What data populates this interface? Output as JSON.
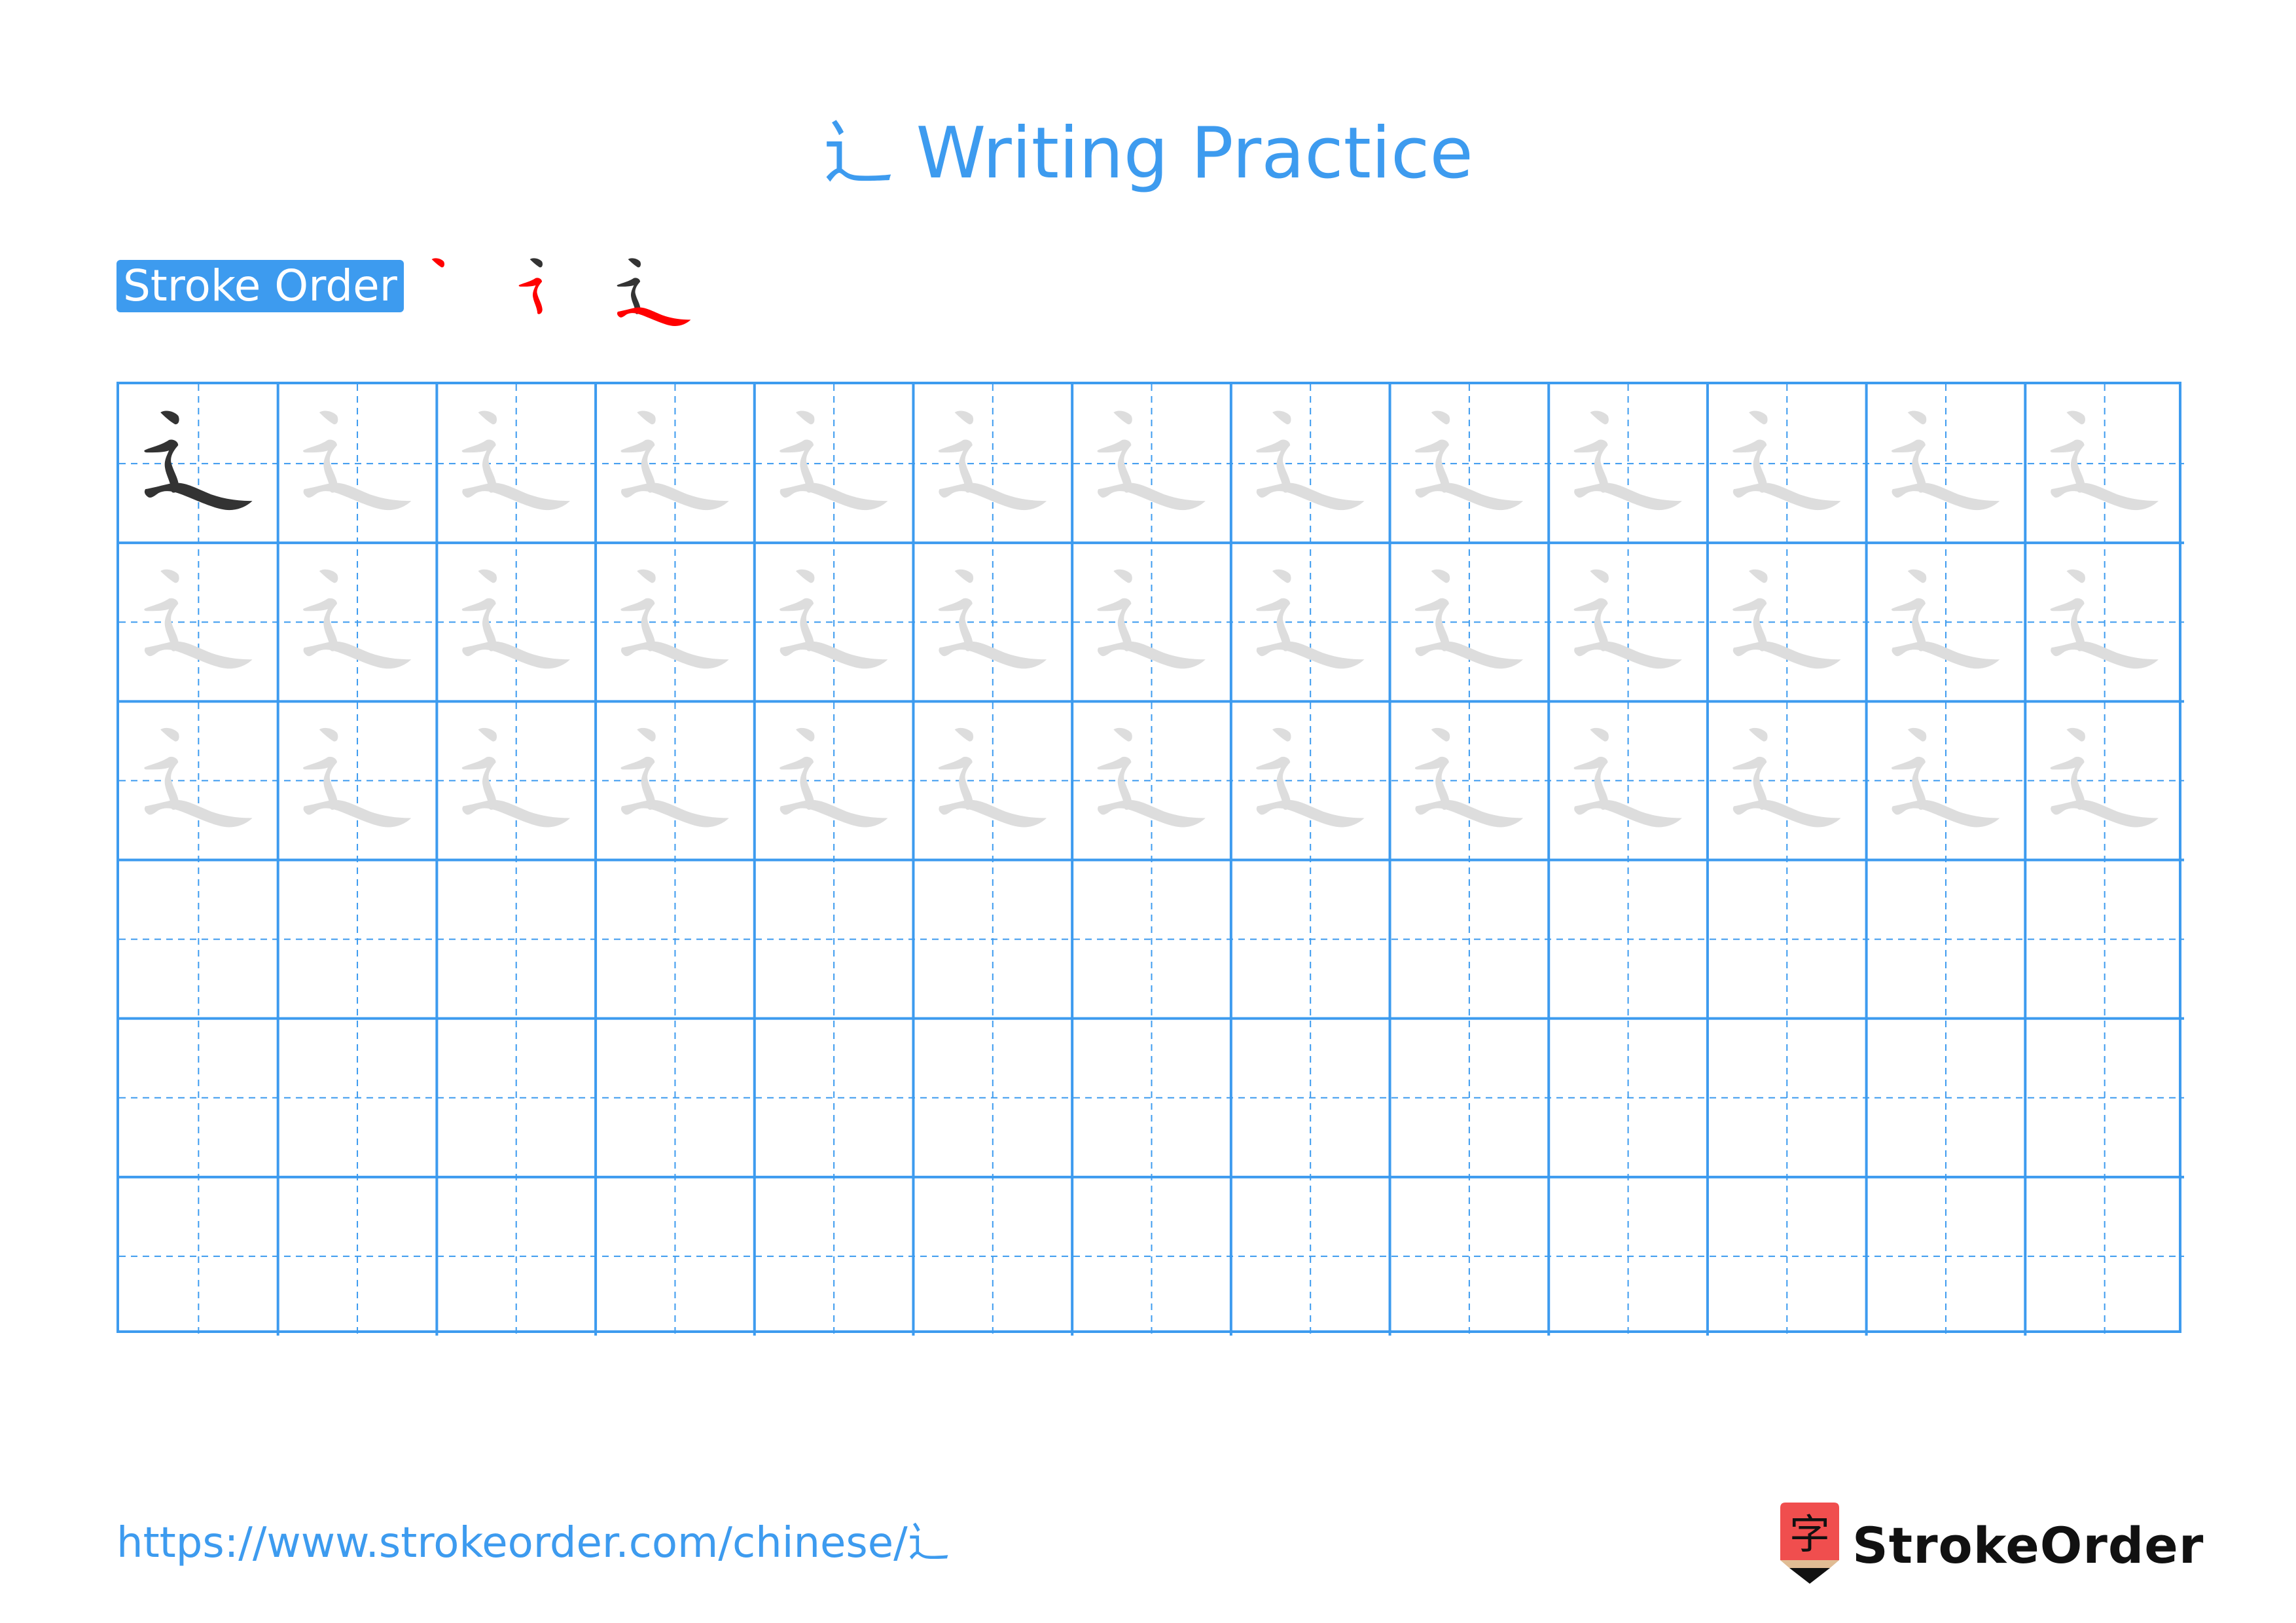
{
  "page": {
    "character": "辶",
    "title": "辶 Writing Practice",
    "stroke_order_label": "Stroke Order",
    "stroke_count": 3,
    "footer_url": "https://www.strokeorder.com/chinese/辶",
    "brand_name": "StrokeOrder",
    "logo_glyph": "字"
  },
  "grid": {
    "columns": 13,
    "rows": 6,
    "model_rows": 1,
    "trace_rows": 2,
    "blank_rows": 3
  },
  "colors": {
    "accent": "#3d9bef",
    "model_char": "#333333",
    "trace_char": "#dddddd",
    "stroke_highlight": "#ff0000",
    "logo_red": "#f04e4e",
    "logo_tan": "#e0bc94",
    "logo_text": "#111111"
  }
}
